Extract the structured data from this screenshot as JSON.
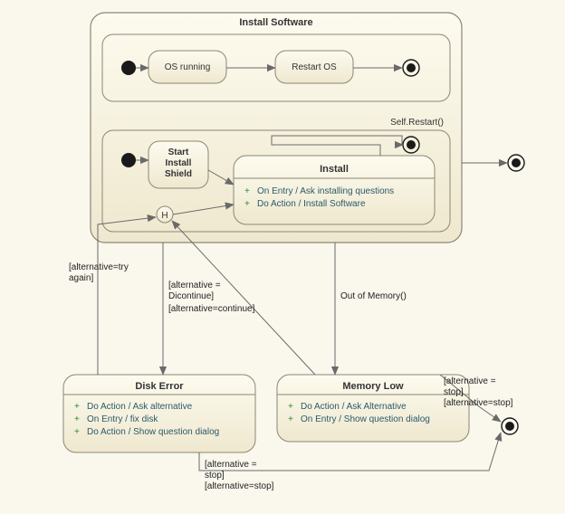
{
  "container": {
    "title": "Install Software",
    "selfRestart": "Self.Restart()"
  },
  "region1": {
    "osRunning": "OS running",
    "restartOS": "Restart OS"
  },
  "region2": {
    "startInstallShield": {
      "l1": "Start",
      "l2": "Install",
      "l3": "Shield"
    },
    "install": {
      "title": "Install",
      "f1": "On Entry / Ask installing questions",
      "f2": "Do Action / Install Software"
    },
    "history": "H"
  },
  "edges": {
    "tryAgain": {
      "l1": "[alternative=try",
      "l2": "again]"
    },
    "discontinue": {
      "l1": "[alternative =",
      "l2": "Dicontinue]"
    },
    "continue": "[alternative=continue]",
    "outOfMemory": "Out of Memory()",
    "stopA": {
      "l1": "[alternative =",
      "l2": "stop]",
      "l3": "[alternative=stop]"
    },
    "stopB": {
      "l1": "[alternative =",
      "l2": "stop]",
      "l3": "[alternative=stop]"
    }
  },
  "diskError": {
    "title": "Disk Error",
    "f1": "Do Action / Ask alternative",
    "f2": "On Entry / fix disk",
    "f3": "Do Action / Show question dialog"
  },
  "memoryLow": {
    "title": "Memory Low",
    "f1": "Do Action / Ask Alternative",
    "f2": "On Entry / Show question dialog"
  }
}
